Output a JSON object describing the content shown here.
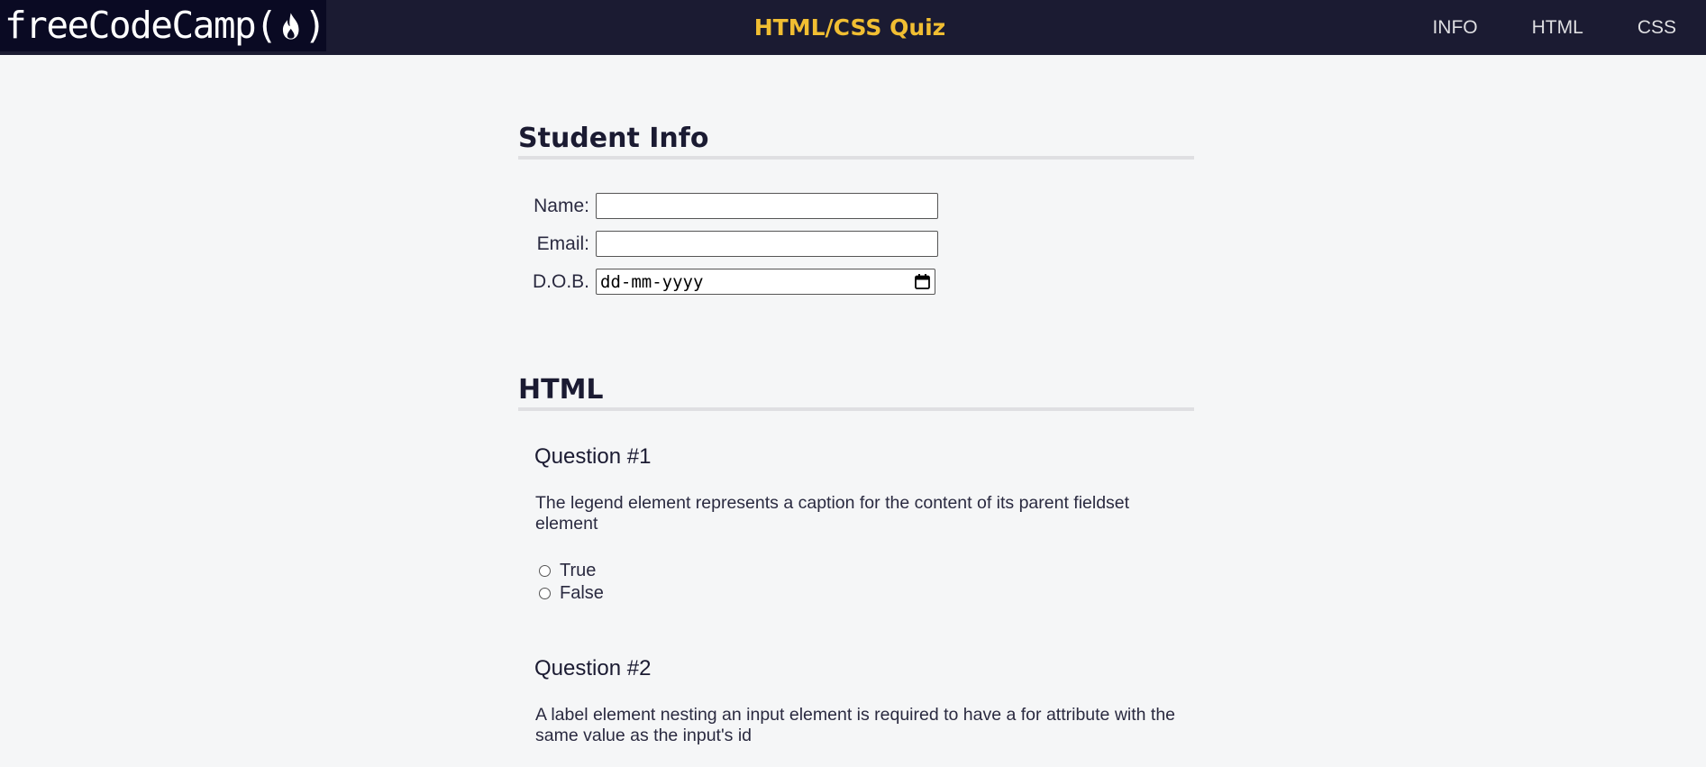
{
  "header": {
    "logo_text": "freeCodeCamp",
    "logo_open": "(",
    "logo_close": ")",
    "title": "HTML/CSS Quiz",
    "nav": [
      "INFO",
      "HTML",
      "CSS"
    ]
  },
  "student_info": {
    "heading": "Student Info",
    "name_label": "Name:",
    "email_label": "Email:",
    "dob_label": "D.O.B.",
    "dob_placeholder": "dd-mm-yyyy"
  },
  "html_section": {
    "heading": "HTML",
    "questions": [
      {
        "title": "Question #1",
        "text": "The legend element represents a caption for the content of its parent fieldset element",
        "options": [
          "True",
          "False"
        ]
      },
      {
        "title": "Question #2",
        "text": "A label element nesting an input element is required to have a for attribute with the same value as the input's id"
      }
    ]
  },
  "colors": {
    "header_bg": "#1b1b32",
    "logo_bg": "#0a0a23",
    "title_accent": "#f1be32",
    "page_bg": "#f5f6f7"
  },
  "icons": {
    "logo": "flame-icon",
    "date_picker": "calendar-icon"
  }
}
